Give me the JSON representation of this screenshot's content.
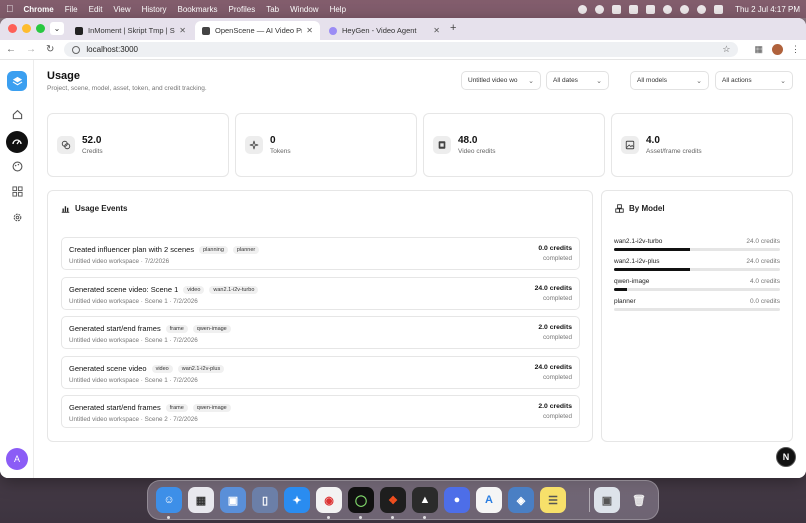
{
  "menubar": {
    "app": "Chrome",
    "items": [
      "File",
      "Edit",
      "View",
      "History",
      "Bookmarks",
      "Profiles",
      "Tab",
      "Window",
      "Help"
    ],
    "clock": "Thu 2 Jul  4:17 PM"
  },
  "browser": {
    "tabs": [
      {
        "title": "InMoment | Skript Tmp | Supa",
        "color": "#222222"
      },
      {
        "title": "OpenScene — AI Video Produ",
        "color": "#444444"
      },
      {
        "title": "HeyGen - Video Agent",
        "color": "#9b8cf5"
      }
    ],
    "url": "localhost:3000"
  },
  "sidebar": {
    "logo_icon": "layers-icon",
    "items": [
      "home-icon",
      "gauge-icon",
      "palette-icon",
      "grid-icon",
      "gear-icon"
    ],
    "avatar": "A"
  },
  "header": {
    "title": "Usage",
    "subtitle": "Project, scene, model, asset, token, and credit tracking."
  },
  "filters": {
    "workspace": "Untitled video wo",
    "dates": "All dates",
    "models": "All models",
    "actions": "All actions"
  },
  "stats": [
    {
      "value": "52.0",
      "label": "Credits",
      "icon": "coins-icon"
    },
    {
      "value": "0",
      "label": "Tokens",
      "icon": "sparkle-icon"
    },
    {
      "value": "48.0",
      "label": "Video credits",
      "icon": "film-icon"
    },
    {
      "value": "4.0",
      "label": "Asset/frame credits",
      "icon": "image-icon"
    }
  ],
  "events_panel": {
    "title": "Usage Events",
    "events": [
      {
        "title": "Created influencer plan with 2 scenes",
        "tags": [
          "planning",
          "planner"
        ],
        "meta": "Untitled video workspace · 7/2/2026",
        "credits": "0.0 credits",
        "status": "completed"
      },
      {
        "title": "Generated scene video: Scene 1",
        "tags": [
          "video",
          "wan2.1-i2v-turbo"
        ],
        "meta": "Untitled video workspace · Scene 1 · 7/2/2026",
        "credits": "24.0 credits",
        "status": "completed"
      },
      {
        "title": "Generated start/end frames",
        "tags": [
          "frame",
          "qwen-image"
        ],
        "meta": "Untitled video workspace · Scene 1 · 7/2/2026",
        "credits": "2.0 credits",
        "status": "completed"
      },
      {
        "title": "Generated scene video",
        "tags": [
          "video",
          "wan2.1-i2v-plus"
        ],
        "meta": "Untitled video workspace · Scene 1 · 7/2/2026",
        "credits": "24.0 credits",
        "status": "completed"
      },
      {
        "title": "Generated start/end frames",
        "tags": [
          "frame",
          "qwen-image"
        ],
        "meta": "Untitled video workspace · Scene 2 · 7/2/2026",
        "credits": "2.0 credits",
        "status": "completed"
      }
    ]
  },
  "model_panel": {
    "title": "By Model",
    "models": [
      {
        "name": "wan2.1-i2v-turbo",
        "credits": "24.0 credits",
        "share": 0.46
      },
      {
        "name": "wan2.1-i2v-plus",
        "credits": "24.0 credits",
        "share": 0.46
      },
      {
        "name": "qwen-image",
        "credits": "4.0 credits",
        "share": 0.08
      },
      {
        "name": "planner",
        "credits": "0.0 credits",
        "share": 0
      }
    ]
  },
  "fab": "N",
  "dock": [
    "Finder",
    "Launchpad",
    "Safari",
    "Chrome",
    "Activity",
    "Figma",
    "Cursor",
    "App Store",
    "Photos",
    "Notes",
    "Trash"
  ]
}
